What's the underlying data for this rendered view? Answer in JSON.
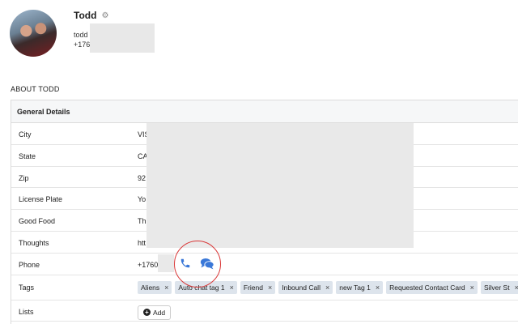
{
  "contact": {
    "name": "Todd",
    "email_partial": "todd",
    "phone_partial": "+176"
  },
  "section_title": "ABOUT TODD",
  "panel_title": "General Details",
  "fields": [
    {
      "label": "City",
      "value": "VIS"
    },
    {
      "label": "State",
      "value": "CA"
    },
    {
      "label": "Zip",
      "value": "92"
    },
    {
      "label": "License Plate",
      "value": "Yo"
    },
    {
      "label": "Good Food",
      "value": "Th"
    },
    {
      "label": "Thoughts",
      "value": "htt"
    },
    {
      "label": "Phone",
      "value": "+1760"
    }
  ],
  "tags_label": "Tags",
  "tags": [
    "Aliens",
    "Auto chat tag 1",
    "Friend",
    "Inbound Call",
    "new Tag 1",
    "Requested Contact Card",
    "Silver St"
  ],
  "tag_remove": "×",
  "lists_label": "Lists",
  "add_label": "Add",
  "icons": {
    "settings": "gear-icon",
    "phone": "phone-icon",
    "chat": "chat-icon",
    "add": "plus-icon",
    "accent": "#3a78d8",
    "highlight": "#d93838"
  }
}
